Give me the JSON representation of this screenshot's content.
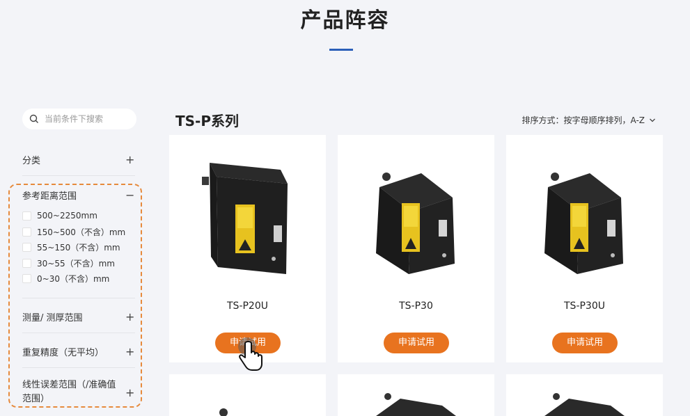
{
  "page": {
    "title": "产品阵容"
  },
  "search": {
    "placeholder": "当前条件下搜索"
  },
  "filters": [
    {
      "label": "分类",
      "toggle": "+"
    },
    {
      "label": "参考距离范围",
      "toggle": "−"
    },
    {
      "label": "测量/ 测厚范围",
      "toggle": "+"
    },
    {
      "label": "重复精度（无平均）",
      "toggle": "+"
    },
    {
      "label": "线性误差范围（/准确值范围）",
      "toggle": "+"
    }
  ],
  "options": [
    "500~2250mm",
    "150~500（不含）mm",
    "55~150（不含）mm",
    "30~55（不含）mm",
    "0~30（不含）mm"
  ],
  "series": {
    "title": "TS-P系列"
  },
  "sort": {
    "label": "排序方式：按字母顺序排列，A-Z"
  },
  "products": [
    {
      "name": "TS-P20U",
      "button": "申请试用"
    },
    {
      "name": "TS-P30",
      "button": "申请试用"
    },
    {
      "name": "TS-P30U",
      "button": "申请试用"
    }
  ],
  "colors": {
    "accent": "#e8731f",
    "title_bar": "#2b5fb9",
    "dashed_highlight": "#e68a3c",
    "background": "#f3f4f8"
  }
}
